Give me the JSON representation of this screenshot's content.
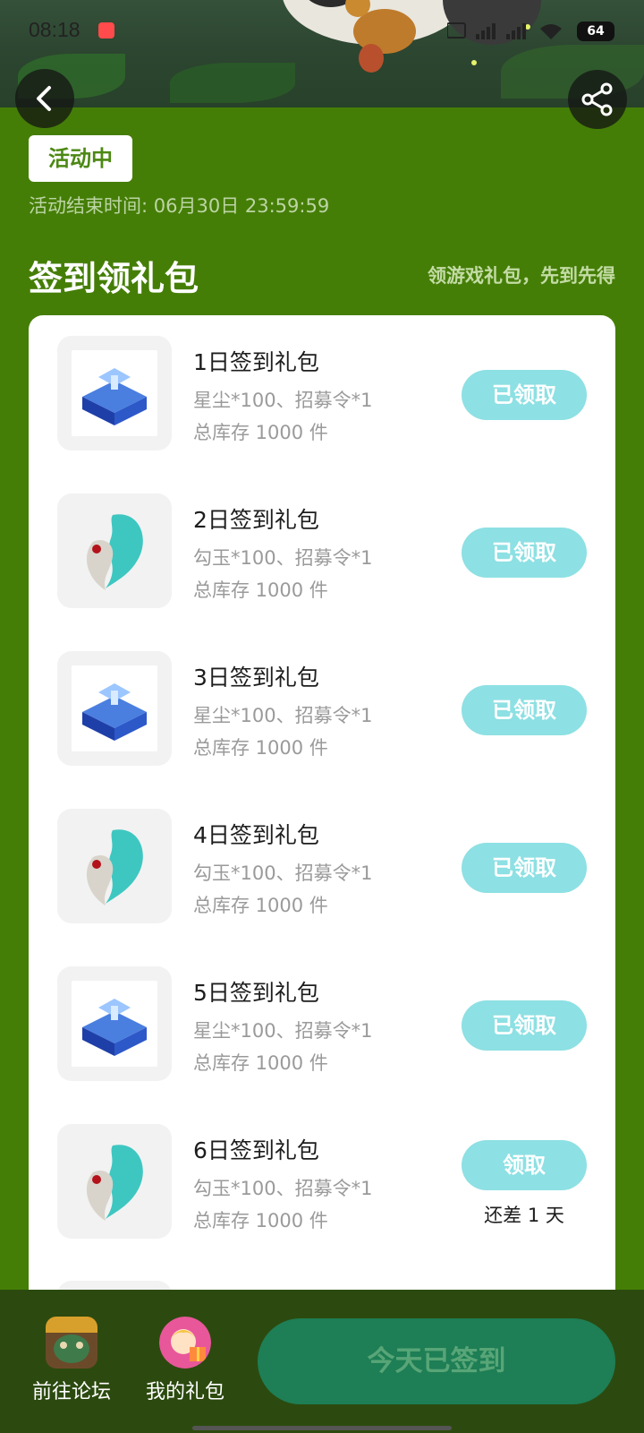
{
  "status_bar": {
    "time": "08:18",
    "battery": "64"
  },
  "header": {
    "badge": "活动中",
    "end_time": "活动结束时间: 06月30日 23:59:59"
  },
  "section": {
    "title": "签到领礼包",
    "subtitle": "领游戏礼包，先到先得"
  },
  "gifts": [
    {
      "title": "1日签到礼包",
      "desc": "星尘*100、招募令*1",
      "stock": "总库存 1000 件",
      "button": "已领取",
      "icon": "crystal-chest-icon"
    },
    {
      "title": "2日签到礼包",
      "desc": "勾玉*100、招募令*1",
      "stock": "总库存 1000 件",
      "button": "已领取",
      "icon": "magatama-icon"
    },
    {
      "title": "3日签到礼包",
      "desc": "星尘*100、招募令*1",
      "stock": "总库存 1000 件",
      "button": "已领取",
      "icon": "crystal-chest-icon"
    },
    {
      "title": "4日签到礼包",
      "desc": "勾玉*100、招募令*1",
      "stock": "总库存 1000 件",
      "button": "已领取",
      "icon": "magatama-icon"
    },
    {
      "title": "5日签到礼包",
      "desc": "星尘*100、招募令*1",
      "stock": "总库存 1000 件",
      "button": "已领取",
      "icon": "crystal-chest-icon"
    },
    {
      "title": "6日签到礼包",
      "desc": "勾玉*100、招募令*1",
      "stock": "总库存 1000 件",
      "button": "领取",
      "remain": "还差 1 天",
      "icon": "magatama-icon"
    }
  ],
  "bottom_nav": {
    "forum_label": "前往论坛",
    "gifts_label": "我的礼包",
    "signed_button": "今天已签到"
  },
  "colors": {
    "background": "#457e07",
    "button": "#8de0e3",
    "bottom_bar": "#2c4a0f",
    "signed_button": "#1e7e55"
  }
}
